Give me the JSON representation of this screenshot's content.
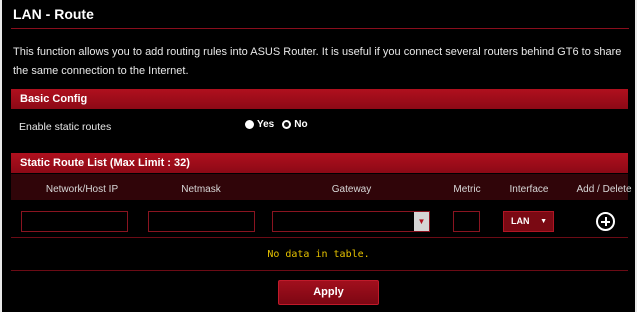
{
  "page": {
    "title": "LAN - Route",
    "description": "This function allows you to add routing rules into ASUS Router. It is useful if you connect several routers behind GT6 to share the same connection to the Internet."
  },
  "basic_config": {
    "header": "Basic Config",
    "enable_label": "Enable static routes",
    "options": [
      "Yes",
      "No"
    ],
    "selected": "No"
  },
  "route_list": {
    "header": "Static Route List (Max Limit : 32)",
    "columns": [
      "Network/Host IP",
      "Netmask",
      "Gateway",
      "Metric",
      "Interface",
      "Add / Delete"
    ],
    "inputs": {
      "network_value": "",
      "netmask_value": "",
      "gateway_value": "",
      "metric_value": "",
      "interface_value": "LAN"
    },
    "empty_message": "No data in table."
  },
  "actions": {
    "apply_label": "Apply"
  },
  "colors": {
    "accent": "#b0101e",
    "background": "#000000",
    "empty_text": "#e6c200"
  },
  "icons": {
    "add": "add-circle-icon",
    "dropdown": "triangle-down-icon"
  }
}
